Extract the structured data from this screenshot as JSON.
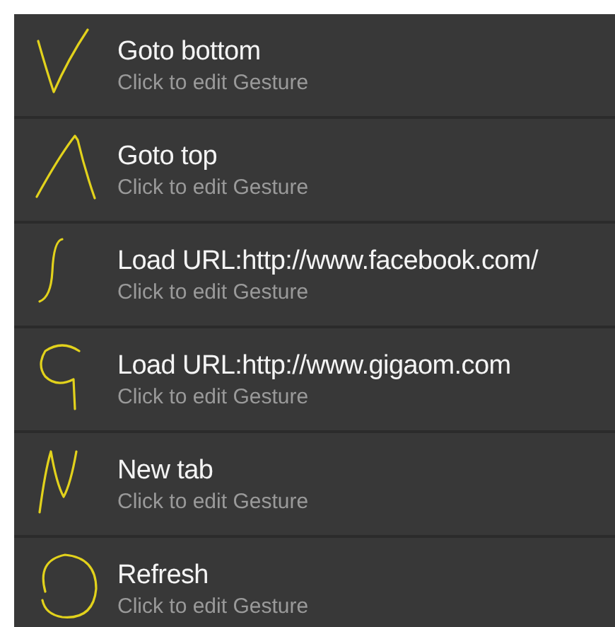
{
  "gestures": [
    {
      "kind": "check",
      "title": "Goto bottom",
      "subtitle": "Click to edit Gesture"
    },
    {
      "kind": "caret",
      "title": "Goto top",
      "subtitle": "Click to edit Gesture"
    },
    {
      "kind": "integral",
      "title": "Load URL:http://www.facebook.com/",
      "subtitle": "Click to edit Gesture"
    },
    {
      "kind": "g",
      "title": "Load URL:http://www.gigaom.com",
      "subtitle": "Click to edit Gesture"
    },
    {
      "kind": "n",
      "title": "New tab",
      "subtitle": "Click to edit Gesture"
    },
    {
      "kind": "circle",
      "title": "Refresh",
      "subtitle": "Click to edit Gesture"
    }
  ]
}
